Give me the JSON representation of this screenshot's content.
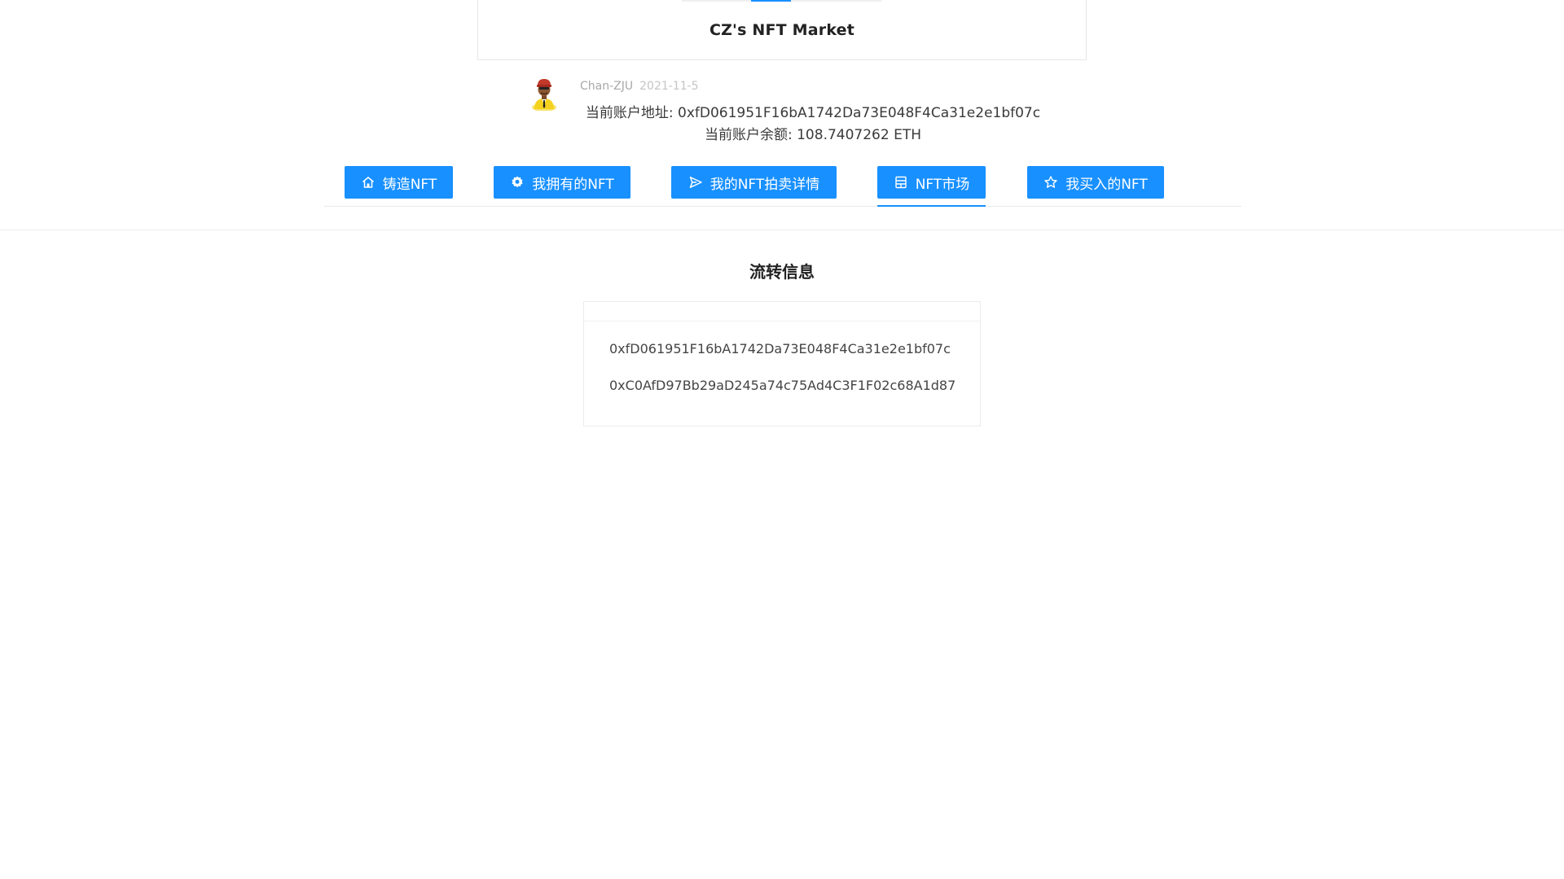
{
  "header": {
    "title": "CZ's NFT Market"
  },
  "author": {
    "name": "Chan-ZJU",
    "date": "2021-11-5",
    "avatar_icon": "avatar-icon"
  },
  "account": {
    "address_label": "当前账户地址: 0xfD061951F16bA1742Da73E048F4Ca31e2e1bf07c",
    "balance_label": "当前账户余额: 108.7407262 ETH"
  },
  "nav": {
    "items": [
      {
        "label": "铸造NFT",
        "icon": "home-icon",
        "active": false
      },
      {
        "label": "我拥有的NFT",
        "icon": "gear-icon",
        "active": false
      },
      {
        "label": "我的NFT拍卖详情",
        "icon": "send-icon",
        "active": false
      },
      {
        "label": "NFT市场",
        "icon": "calculator-icon",
        "active": true
      },
      {
        "label": "我买入的NFT",
        "icon": "star-icon",
        "active": false
      }
    ]
  },
  "section": {
    "title": "流转信息",
    "addresses": [
      "0xfD061951F16bA1742Da73E048F4Ca31e2e1bf07c",
      "0xC0AfD97Bb29aD245a74c75Ad4C3F1F02c68A1d87"
    ]
  },
  "colors": {
    "accent": "#1890ff",
    "text": "#333333",
    "muted": "#a8a8a8",
    "border": "#e6e6e6"
  }
}
